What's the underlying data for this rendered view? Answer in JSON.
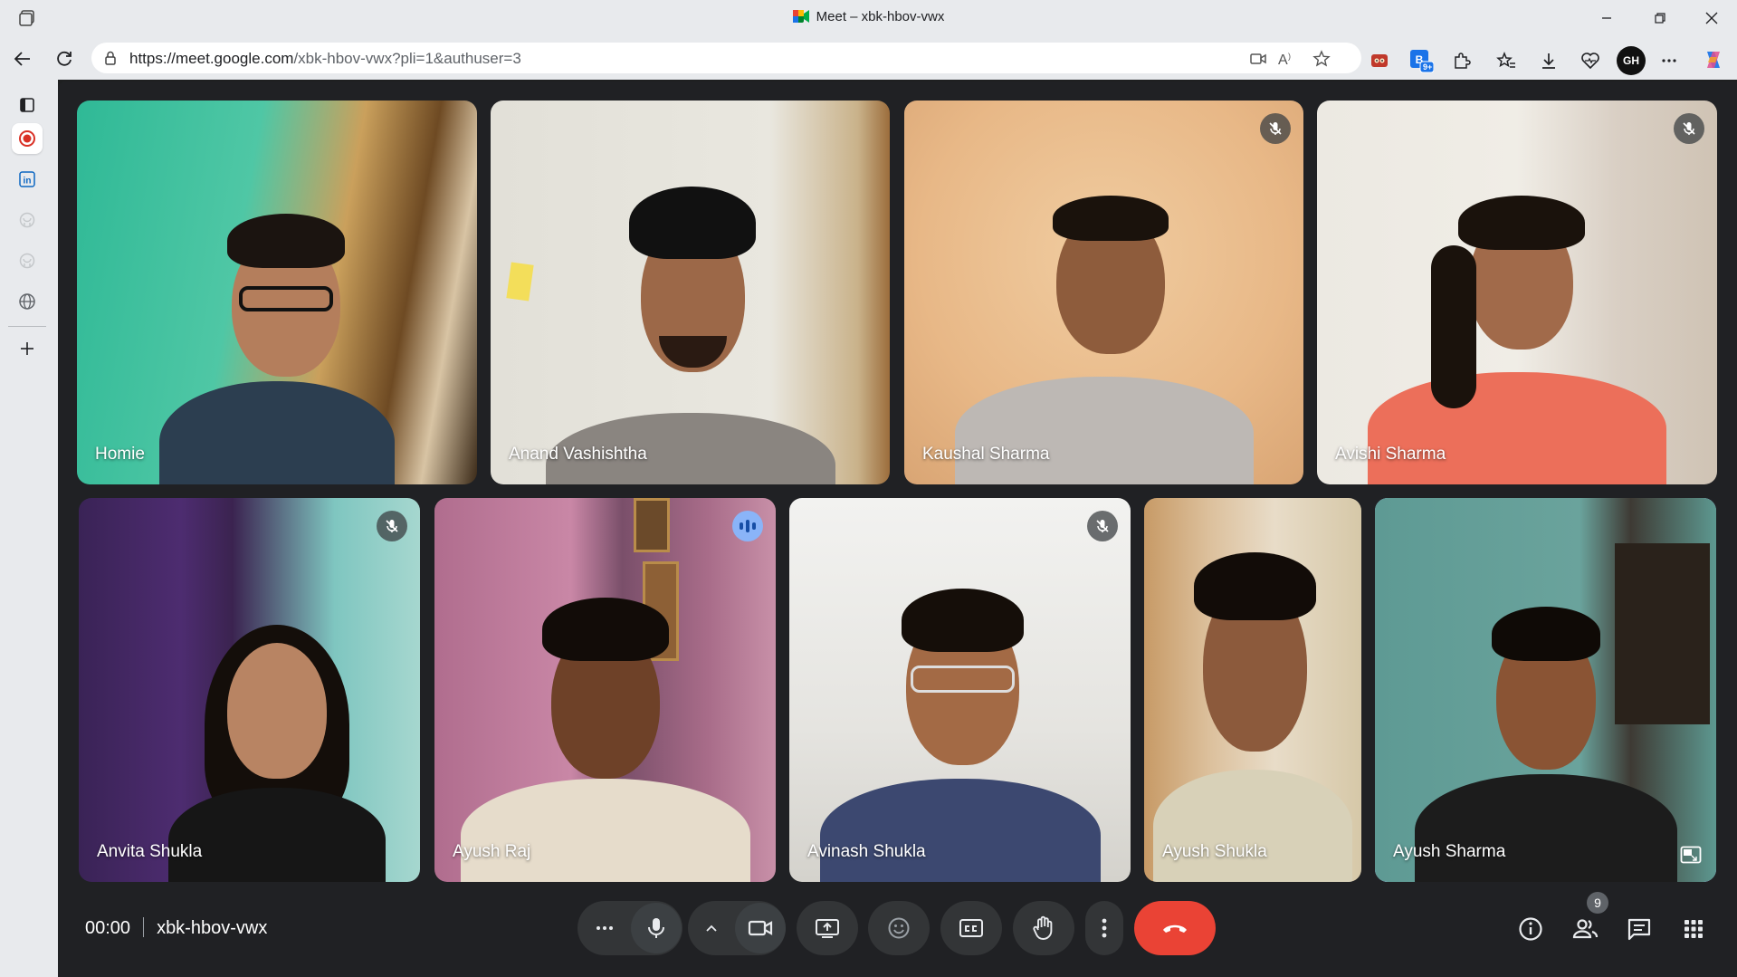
{
  "window": {
    "title": "Meet – xbk-hbov-vwx",
    "minimize_icon": "minimize-icon",
    "restore_icon": "restore-icon",
    "close_icon": "close-icon"
  },
  "address_bar": {
    "url_host": "https://meet.google.com",
    "url_path": "/xbk-hbov-vwx?pli=1&authuser=3",
    "extensions_badge": "9+",
    "profile_initials": "GH"
  },
  "meeting": {
    "time": "00:00",
    "code": "xbk-hbov-vwx",
    "people_count": "9"
  },
  "participants": [
    {
      "name": "Homie",
      "muted": false,
      "speaking": false
    },
    {
      "name": "Anand Vashishtha",
      "muted": false,
      "speaking": false
    },
    {
      "name": "Kaushal Sharma",
      "muted": true,
      "speaking": false
    },
    {
      "name": "Avishi Sharma",
      "muted": true,
      "speaking": false
    },
    {
      "name": "Anvita Shukla",
      "muted": true,
      "speaking": false
    },
    {
      "name": "Ayush Raj",
      "muted": false,
      "speaking": true
    },
    {
      "name": "Avinash Shukla",
      "muted": true,
      "speaking": false
    },
    {
      "name": "Ayush Shukla",
      "muted": false,
      "speaking": false
    },
    {
      "name": "Ayush Sharma",
      "muted": false,
      "speaking": false,
      "self": true
    }
  ],
  "colors": {
    "accent": "#8ab4f8",
    "end_call": "#ea4335",
    "control_bg": "#333537",
    "stage_bg": "#202124"
  }
}
